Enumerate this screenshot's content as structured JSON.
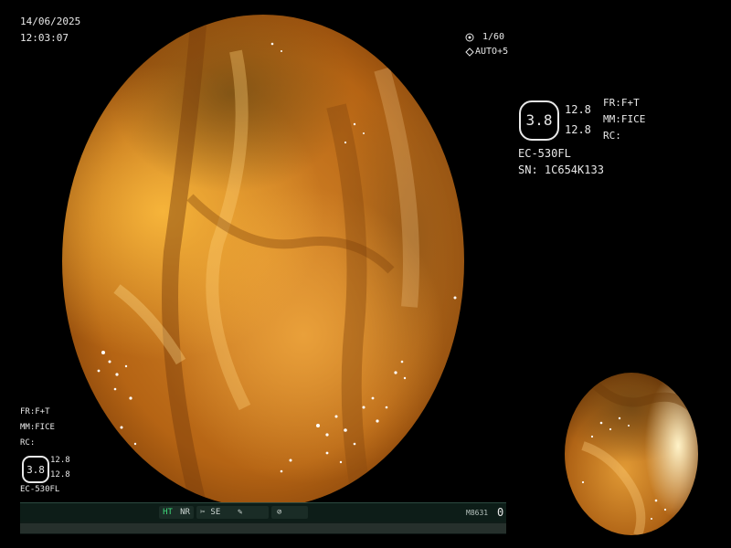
{
  "datetime": {
    "date": "14/06/2025",
    "time": "12:03:07"
  },
  "exposure": {
    "shutter_icon": "shutter-icon",
    "shutter": "1/60",
    "auto_icon": "auto-iris-icon",
    "auto": "AUTO+5"
  },
  "info_panel": {
    "badge_value": "3.8",
    "value_top": "12.8",
    "value_bottom": "12.8",
    "fr": "FR:F+T",
    "mm": "MM:FICE",
    "rc": "RC:",
    "scope_model": "EC-530FL",
    "serial": "SN: 1C654K133"
  },
  "bottom_left_panel": {
    "fr": "FR:F+T",
    "mm": "MM:FICE",
    "rc": "RC:",
    "badge_value": "3.8",
    "value_top": "12.8",
    "value_bottom": "12.8",
    "scope_model": "EC-530FL"
  },
  "status_bar": {
    "ht": "HT",
    "nr": "NR",
    "se_icon": "scissor-icon",
    "se": "SE",
    "pencil_icon": "pencil-icon",
    "record_icon": "record-icon",
    "code": "M8631",
    "counter": "0"
  },
  "colors": {
    "ht_accent": "#3fd87a",
    "text": "#e8e8e8",
    "bar_bg": "#0d1d18"
  }
}
